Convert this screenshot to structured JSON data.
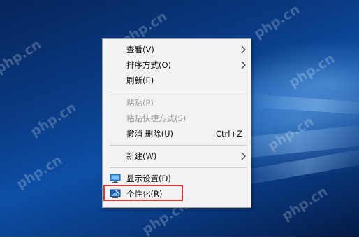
{
  "watermark": "php.cn",
  "menu": {
    "items": [
      {
        "label": "查看(V)",
        "submenu": true,
        "disabled": false
      },
      {
        "label": "排序方式(O)",
        "submenu": true,
        "disabled": false
      },
      {
        "label": "刷新(E)",
        "submenu": false,
        "disabled": false
      },
      {
        "label": "粘贴(P)",
        "submenu": false,
        "disabled": true
      },
      {
        "label": "粘贴快捷方式(S)",
        "submenu": false,
        "disabled": true
      },
      {
        "label": "撤消 删除(U)",
        "shortcut": "Ctrl+Z",
        "submenu": false,
        "disabled": false
      },
      {
        "label": "新建(W)",
        "submenu": true,
        "disabled": false
      },
      {
        "label": "显示设置(D)",
        "icon": "display-settings-icon",
        "submenu": false,
        "disabled": false
      },
      {
        "label": "个性化(R)",
        "icon": "personalize-icon",
        "submenu": false,
        "disabled": false,
        "highlighted": true
      }
    ]
  },
  "colors": {
    "highlight_border": "#d63a3a",
    "desktop_blue": "#0d4fa6"
  }
}
